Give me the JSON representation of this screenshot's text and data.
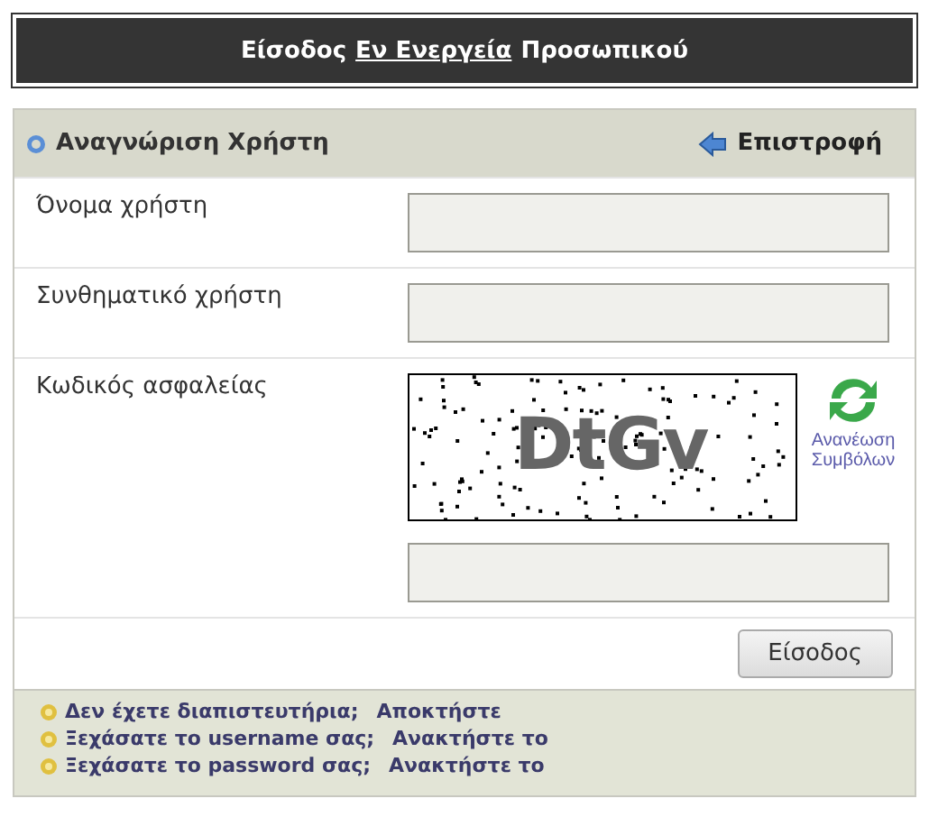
{
  "title": {
    "before": "Είσοδος",
    "link": "Εν Ενεργεία",
    "after": "Προσωπικού"
  },
  "panel": {
    "heading": "Αναγνώριση Χρήστη",
    "back": "Επιστροφή"
  },
  "fields": [
    {
      "label": "Όνομα χρήστη",
      "kind": "input"
    },
    {
      "label": "Συνθηματικό χρήστη",
      "kind": "password"
    },
    {
      "label": "Κωδικός ασφαλείας",
      "kind": "captcha",
      "captcha": "DtGv",
      "refresh": "Ανανέωση Συμβόλων"
    }
  ],
  "submit": "Είσοδος",
  "help": [
    {
      "question": "Δεν έχετε διαπιστευτήρια;",
      "link": "Αποκτήστε"
    },
    {
      "question": "Ξεχάσατε το username σας;",
      "link": "Ανακτήστε το"
    },
    {
      "question": "Ξεχάσατε το password σας;",
      "link": "Ανακτήστε το"
    }
  ]
}
